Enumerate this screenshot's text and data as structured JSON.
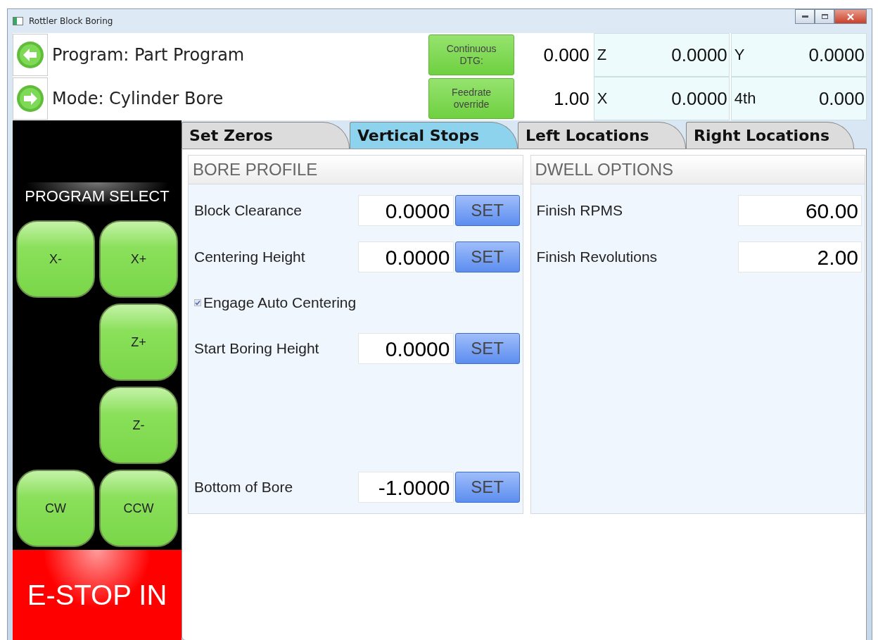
{
  "window": {
    "title": "Rottler Block Boring"
  },
  "header": {
    "rows": [
      {
        "label": "Program: Part Program",
        "button": "Continuous DTG:",
        "value": "0.000",
        "axes": [
          {
            "name": "Z",
            "value": "0.0000"
          },
          {
            "name": "Y",
            "value": "0.0000"
          }
        ]
      },
      {
        "label": "Mode: Cylinder Bore",
        "button": "Feedrate override",
        "value": "1.00",
        "axes": [
          {
            "name": "X",
            "value": "0.0000"
          },
          {
            "name": "4th",
            "value": "0.000"
          }
        ]
      }
    ]
  },
  "sidebar": {
    "title": "PROGRAM SELECT",
    "jog_buttons": [
      {
        "left": "X-",
        "right": "X+"
      },
      {
        "right": "Z+"
      },
      {
        "right": "Z-"
      },
      {
        "left": "CW",
        "right": "CCW"
      }
    ],
    "estop": "E-STOP IN"
  },
  "tabs": [
    {
      "label": "Set Zeros",
      "selected": false
    },
    {
      "label": "Vertical Stops",
      "selected": true
    },
    {
      "label": "Left Locations",
      "selected": false
    },
    {
      "label": "Right Locations",
      "selected": false
    }
  ],
  "bore_profile": {
    "title": "BORE PROFILE",
    "rows": [
      {
        "kind": "field",
        "label": "Block Clearance",
        "value": "0.0000",
        "button": "SET"
      },
      {
        "kind": "field",
        "label": "Centering Height",
        "value": "0.0000",
        "button": "SET"
      },
      {
        "kind": "checkbox",
        "label": "Engage Auto Centering",
        "checked": true
      },
      {
        "kind": "field",
        "label": "Start Boring Height",
        "value": "0.0000",
        "button": "SET"
      },
      {
        "kind": "field",
        "label": "Bottom of Bore",
        "value": "-1.0000",
        "button": "SET"
      }
    ]
  },
  "dwell_options": {
    "title": "DWELL OPTIONS",
    "rows": [
      {
        "label": "Finish RPMS",
        "value": "60.00"
      },
      {
        "label": "Finish Revolutions",
        "value": "2.00"
      }
    ]
  }
}
